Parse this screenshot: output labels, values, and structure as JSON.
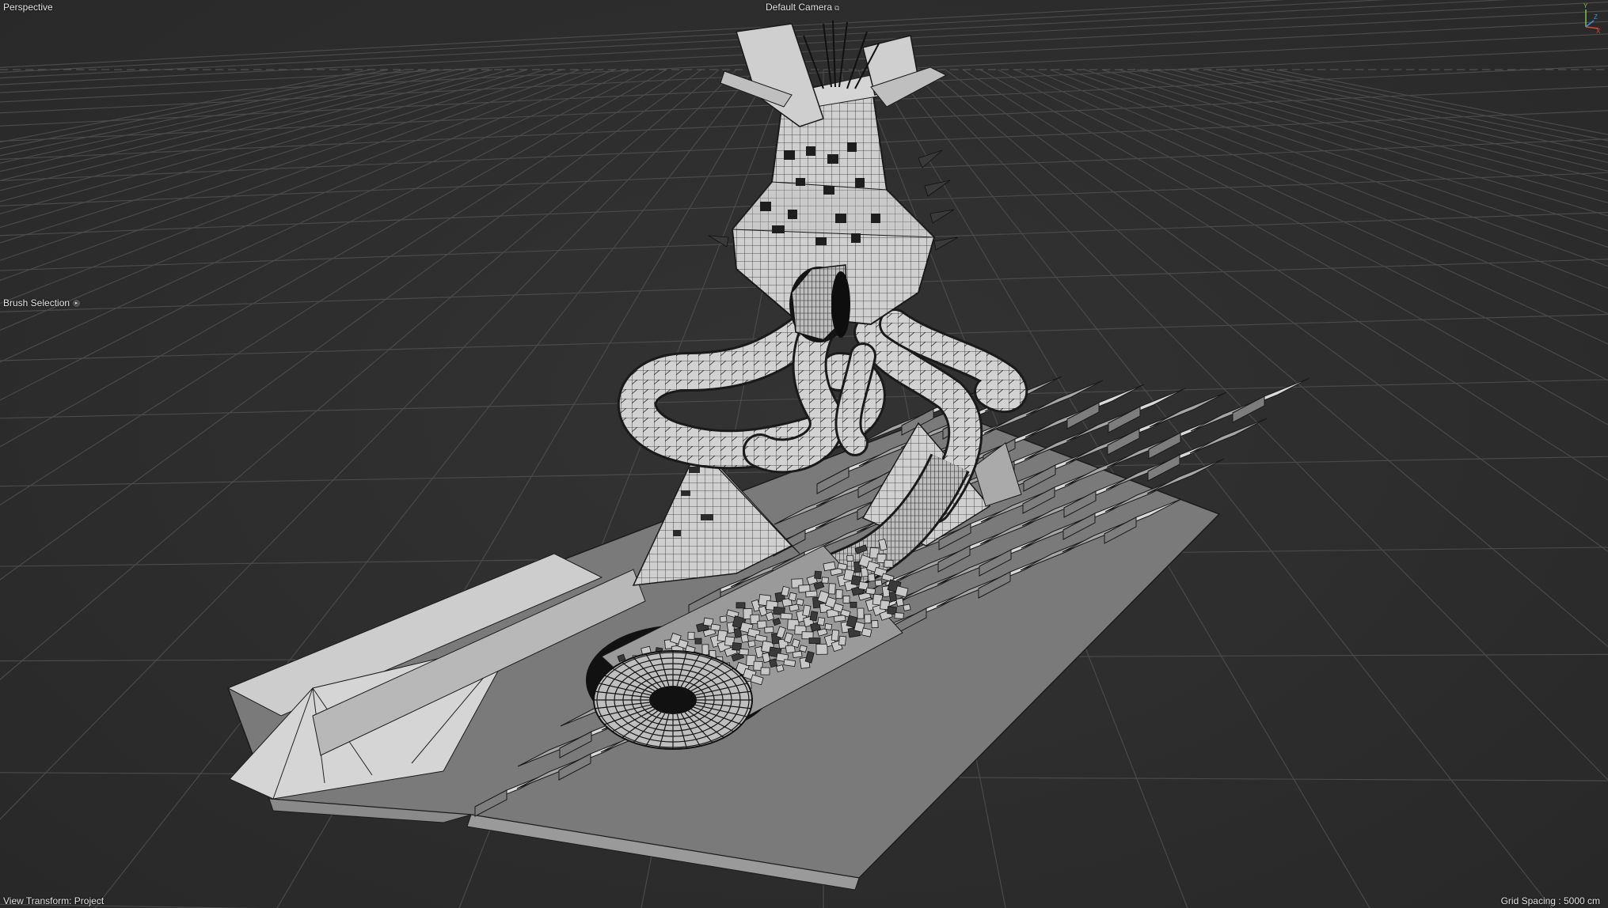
{
  "viewport": {
    "view_label": "Perspective",
    "camera_label": "Default Camera",
    "camera_icon": "camera-menu-icon",
    "brush_selection_label": "Brush Selection",
    "brush_selection_icon": "dropdown-circle-icon",
    "view_transform_label": "View Transform: Project",
    "grid_spacing_label": "Grid Spacing : 5000 cm"
  },
  "axis_gizmo": {
    "y_label": "Y",
    "z_label": "Z",
    "x_label": "X",
    "colors": {
      "x": "#e0463a",
      "y": "#7fbf4a",
      "z": "#3f8fe0"
    }
  },
  "colors": {
    "background": "#2f2f2f",
    "grid_line": "#4a4a4a",
    "mesh_light": "#d8d8d8",
    "mesh_mid": "#a9a9a9",
    "mesh_dark": "#6e6e6e",
    "wire": "#1b1b1b"
  }
}
